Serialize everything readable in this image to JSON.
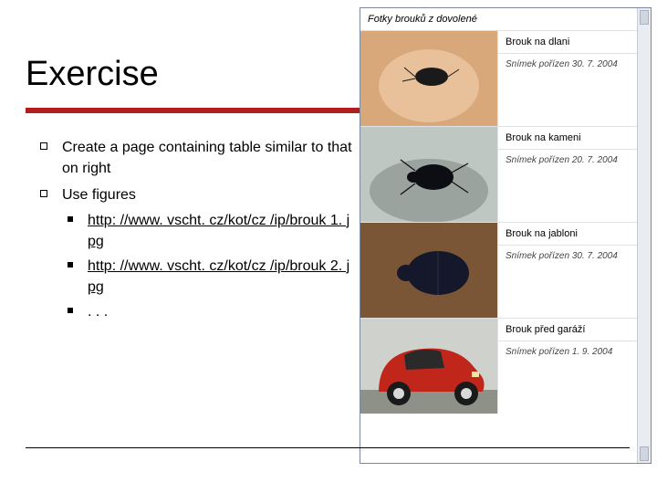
{
  "title": "Exercise",
  "bullets": [
    {
      "text": "Create a page containing table similar to that on right"
    },
    {
      "text": "Use figures",
      "sub": [
        {
          "text": "http: //www. vscht. cz/kot/cz /ip/brouk 1. jpg",
          "link": true
        },
        {
          "text": "http: //www. vscht. cz/kot/cz /ip/brouk 2. jpg",
          "link": true
        },
        {
          "text": ". . .",
          "link": false
        }
      ]
    }
  ],
  "example": {
    "caption": "Fotky brouků z dovolené",
    "rows": [
      {
        "title": "Brouk na dlani",
        "date": "Snímek pořízen 30. 7. 2004"
      },
      {
        "title": "Brouk na kameni",
        "date": "Snímek pořízen 20. 7. 2004"
      },
      {
        "title": "Brouk na jabloni",
        "date": "Snímek pořízen 30. 7. 2004"
      },
      {
        "title": "Brouk před garáží",
        "date": "Snímek pořízen 1. 9. 2004"
      }
    ]
  }
}
